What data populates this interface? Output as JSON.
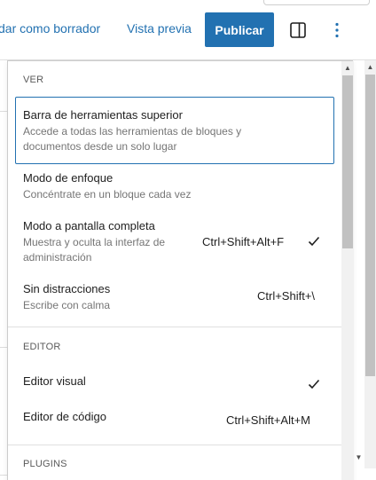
{
  "toolbar": {
    "save_draft_label": "dar como borrador",
    "preview_label": "Vista previa",
    "publish_label": "Publicar",
    "sidebar_toggle_icon": "sidebar-toggle-icon",
    "options_icon": "kebab-menu-icon",
    "accent_color": "#2271b1"
  },
  "menu": {
    "view_group": {
      "title": "VER",
      "items": [
        {
          "label": "Barra de herramientas superior",
          "description": "Accede a todas las herramientas de bloques y documentos desde un solo lugar",
          "shortcut": "",
          "checked": false,
          "focused": true
        },
        {
          "label": "Modo de enfoque",
          "description": "Concéntrate en un bloque cada vez",
          "shortcut": "",
          "checked": false
        },
        {
          "label": "Modo a pantalla completa",
          "description": "Muestra y oculta la interfaz de administración",
          "shortcut": "Ctrl+Shift+Alt+F",
          "checked": true
        },
        {
          "label": "Sin distracciones",
          "description": "Escribe con calma",
          "shortcut": "Ctrl+Shift+\\",
          "checked": false
        }
      ]
    },
    "editor_group": {
      "title": "EDITOR",
      "items": [
        {
          "label": "Editor visual",
          "shortcut": "",
          "checked": true
        },
        {
          "label": "Editor de código",
          "shortcut": "Ctrl+Shift+Alt+M",
          "checked": false
        }
      ]
    },
    "plugins_group": {
      "title": "PLUGINS"
    }
  }
}
